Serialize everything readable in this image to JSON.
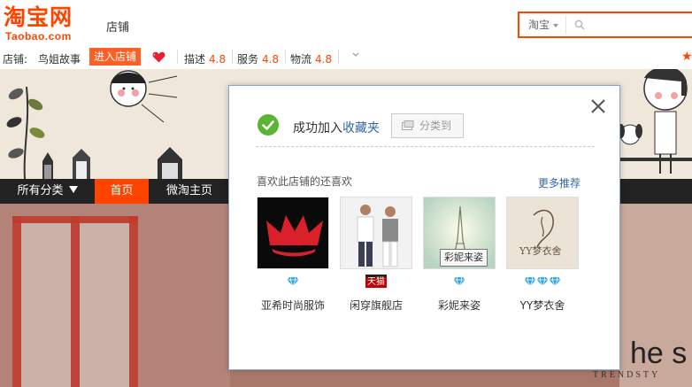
{
  "header": {
    "logo_cn": "淘宝网",
    "logo_en": "Taobao.com",
    "nav_label": "店铺",
    "search_tab": "淘宝",
    "search_placeholder": ""
  },
  "shop_bar": {
    "shop_label": "店铺:",
    "shop_name": "鸟姐故事",
    "enter_button": "进入店铺",
    "ratings": [
      {
        "label": "描述",
        "value": "4.8"
      },
      {
        "label": "服务",
        "value": "4.8"
      },
      {
        "label": "物流",
        "value": "4.8"
      }
    ]
  },
  "shop_nav": {
    "items": [
      "所有分类",
      "首页",
      "微淘主页"
    ],
    "active_index": 1
  },
  "banner_text": {
    "photo_text_big": "he s",
    "photo_text_small": "TRENDSTY"
  },
  "dialog": {
    "success_prefix": "成功加入",
    "success_link": "收藏夹",
    "classify_button": "分类到",
    "recommend_title": "喜欢此店铺的还喜欢",
    "more_link": "更多推荐",
    "shops": [
      {
        "name": "亚希时尚服饰",
        "badge": "diamond",
        "badge_count": 1
      },
      {
        "name": "闲穿旗舰店",
        "badge": "tmall",
        "badge_text": "天猫"
      },
      {
        "name": "彩妮来姿",
        "badge": "diamond",
        "badge_count": 1,
        "tooltip": "彩妮来姿"
      },
      {
        "name": "YY梦衣舍",
        "badge": "diamond",
        "badge_count": 3,
        "logo_text": "YY梦衣舍"
      }
    ]
  },
  "colors": {
    "brand": "#ff4400",
    "link": "#3366aa",
    "nav_bg": "#222222",
    "diamond": "#2aa6e0"
  }
}
